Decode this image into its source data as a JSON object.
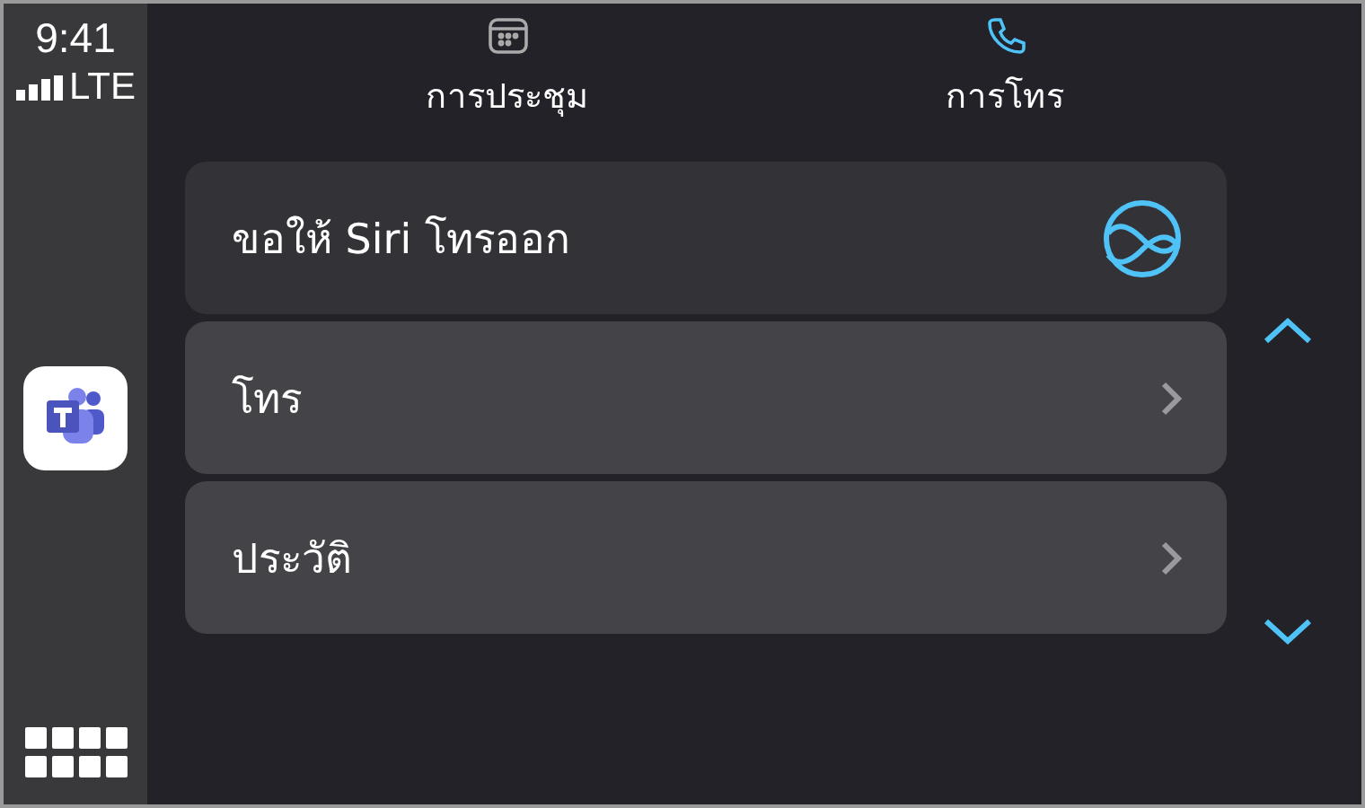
{
  "status": {
    "time": "9:41",
    "network": "LTE"
  },
  "tabs": [
    {
      "label": "การประชุม",
      "selected": false,
      "kind": "calendar"
    },
    {
      "label": "การโทร",
      "selected": true,
      "kind": "phone"
    }
  ],
  "rows": [
    {
      "label": "ขอให้ Siri โทรออก",
      "kind": "siri",
      "selected": true
    },
    {
      "label": "โทร",
      "kind": "nav",
      "selected": false
    },
    {
      "label": "ประวัติ",
      "kind": "nav",
      "selected": false
    }
  ]
}
